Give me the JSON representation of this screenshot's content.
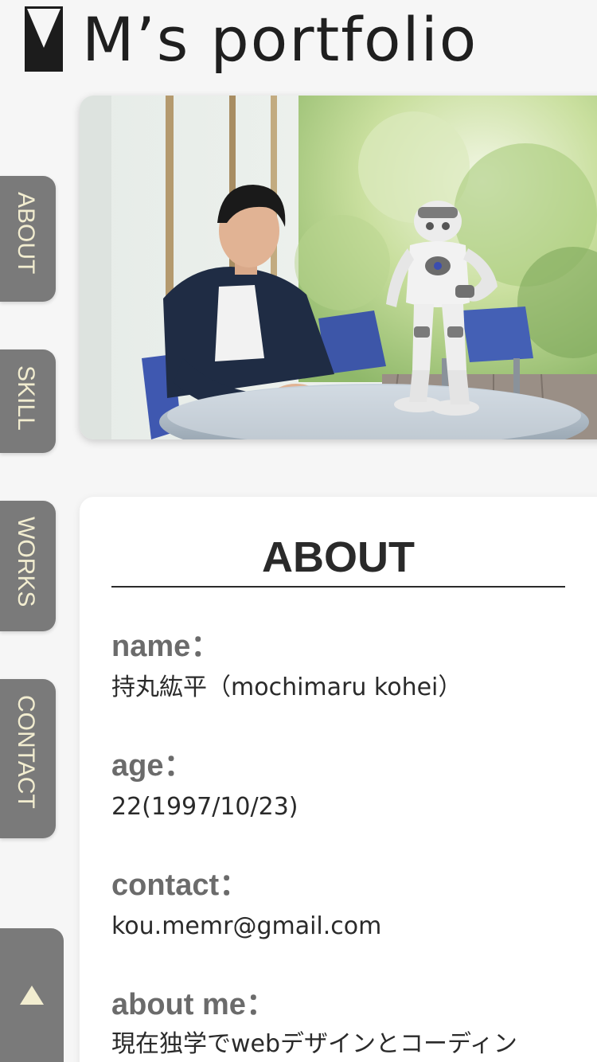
{
  "header": {
    "title": "M’s portfolio"
  },
  "nav": {
    "items": [
      {
        "label": "ABOUT"
      },
      {
        "label": "SKILL"
      },
      {
        "label": "WORKS"
      },
      {
        "label": "CONTACT"
      }
    ]
  },
  "about": {
    "heading": "ABOUT",
    "fields": [
      {
        "label": "name：",
        "value": "持丸紘平（mochimaru kohei）"
      },
      {
        "label": "age：",
        "value": "22(1997/10/23)"
      },
      {
        "label": "contact：",
        "value": "kou.memr@gmail.com"
      },
      {
        "label": "about me：",
        "value": "現在独学でwebデザインとコーディン"
      }
    ]
  },
  "colors": {
    "nav_bg": "#7a7a7a",
    "nav_text": "#f2edd0",
    "title_text": "#1f1f1f",
    "label_text": "#6b6b6b"
  },
  "icons": {
    "logo": "m-logo-icon",
    "back_to_top": "up-arrow-icon"
  }
}
